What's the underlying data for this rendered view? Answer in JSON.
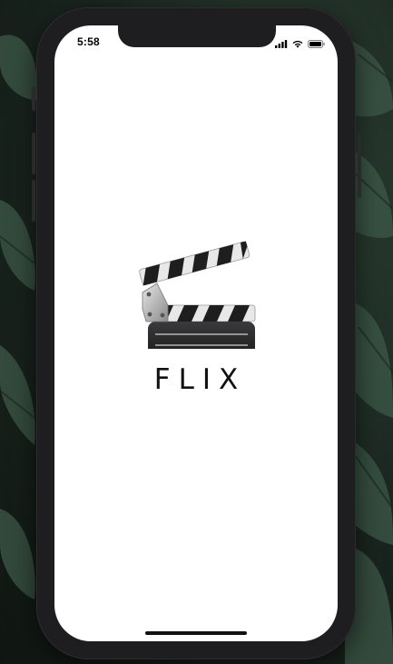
{
  "status_bar": {
    "time": "5:58",
    "icons": [
      "signal-icon",
      "wifi-icon",
      "battery-icon"
    ]
  },
  "splash": {
    "logo_icon": "clapperboard-icon",
    "title": "FLIX"
  },
  "colors": {
    "screen_background": "#ffffff",
    "title_text": "#111111",
    "device_frame": "#1e1e20"
  }
}
